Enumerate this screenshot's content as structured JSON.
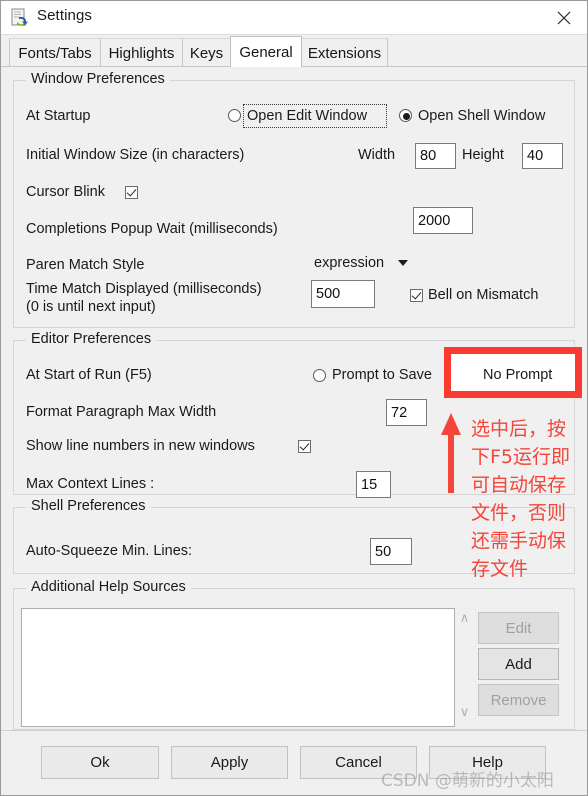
{
  "window": {
    "title": "Settings",
    "icon": "idle-settings-icon",
    "close_label": "✕"
  },
  "tabs": [
    {
      "label": "Fonts/Tabs",
      "active": false
    },
    {
      "label": "Highlights",
      "active": false
    },
    {
      "label": "Keys",
      "active": false
    },
    {
      "label": "General",
      "active": true
    },
    {
      "label": "Extensions",
      "active": false
    }
  ],
  "window_preferences": {
    "title": "Window Preferences",
    "at_startup_label": "At Startup",
    "startup_options": [
      {
        "label": "Open Edit Window",
        "selected": false,
        "focused": true
      },
      {
        "label": "Open Shell Window",
        "selected": true,
        "focused": false
      }
    ],
    "initial_size_label": "Initial Window Size  (in characters)",
    "width_label": "Width",
    "width_value": "80",
    "height_label": "Height",
    "height_value": "40",
    "cursor_blink_label": "Cursor Blink",
    "cursor_blink_checked": true,
    "completions_label": "Completions Popup Wait (milliseconds)",
    "completions_value": "2000",
    "paren_match_label": "Paren Match Style",
    "paren_match_value": "expression",
    "time_match_label": "Time Match Displayed (milliseconds)",
    "time_match_label2": "(0 is until next input)",
    "time_match_value": "500",
    "bell_label": "Bell on Mismatch",
    "bell_checked": true
  },
  "editor_preferences": {
    "title": "Editor Preferences",
    "at_start_of_run_label": "At Start of Run (F5)",
    "run_options": [
      {
        "label": "Prompt to Save",
        "selected": false
      },
      {
        "label": "No Prompt",
        "selected": true
      }
    ],
    "format_width_label": "Format Paragraph Max Width",
    "format_width_value": "72",
    "line_numbers_label": "Show line numbers in new windows",
    "line_numbers_checked": true,
    "max_context_label": "Max Context Lines :",
    "max_context_value": "15"
  },
  "shell_preferences": {
    "title": "Shell Preferences",
    "autosqueeze_label": "Auto-Squeeze Min. Lines:",
    "autosqueeze_value": "50"
  },
  "help_sources": {
    "title": "Additional Help Sources",
    "list_items": [],
    "scroll_up": "∧",
    "scroll_down": "∨",
    "buttons": [
      {
        "label": "Edit",
        "enabled": false
      },
      {
        "label": "Add",
        "enabled": true
      },
      {
        "label": "Remove",
        "enabled": false
      }
    ]
  },
  "dialog_buttons": [
    {
      "label": "Ok"
    },
    {
      "label": "Apply"
    },
    {
      "label": "Cancel"
    },
    {
      "label": "Help"
    }
  ],
  "annotation": {
    "highlight_color": "#fb3b30",
    "text_color": "#f4453a",
    "text": "选中后，按\n下F5运行即\n可自动保存\n文件，否则\n还需手动保\n存文件",
    "highlights_target": "No Prompt"
  },
  "watermark": {
    "text": "CSDN @萌新的小太阳"
  }
}
